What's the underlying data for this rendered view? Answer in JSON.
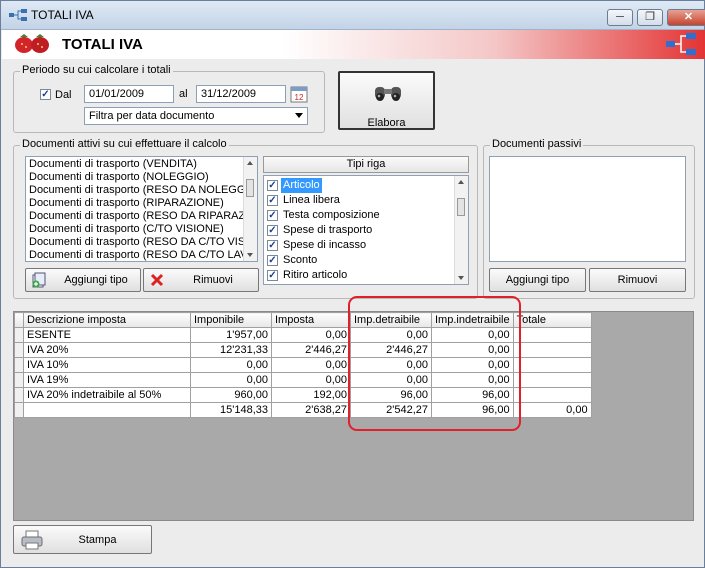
{
  "window": {
    "title": "TOTALI IVA",
    "minimize": "─",
    "maximize": "❐",
    "close": "✕"
  },
  "header": {
    "title": "TOTALI IVA"
  },
  "periodo": {
    "legend": "Periodo su cui calcolare i totali",
    "dal_checked": true,
    "dal_label": "Dal",
    "date_from": "01/01/2009",
    "al_label": "al",
    "date_to": "31/12/2009",
    "filter_selected": "Filtra per data documento"
  },
  "elabora": {
    "label": "Elabora"
  },
  "documenti_attivi": {
    "legend": "Documenti attivi su cui effettuare il calcolo",
    "items": [
      "Documenti di trasporto (VENDITA)",
      "Documenti di trasporto (NOLEGGIO)",
      "Documenti di trasporto (RESO DA NOLEGGI",
      "Documenti di trasporto (RIPARAZIONE)",
      "Documenti di trasporto (RESO DA RIPARAZI",
      "Documenti di trasporto (C/TO VISIONE)",
      "Documenti di trasporto (RESO DA C/TO VISI",
      "Documenti di trasporto (RESO DA C/TO LAV"
    ],
    "add_button": "Aggiungi tipo",
    "remove_button": "Rimuovi"
  },
  "tipi_riga": {
    "header": "Tipi riga",
    "items": [
      {
        "label": "Articolo",
        "checked": true,
        "selected": true
      },
      {
        "label": "Linea libera",
        "checked": true,
        "selected": false
      },
      {
        "label": "Testa composizione",
        "checked": true,
        "selected": false
      },
      {
        "label": "Spese di trasporto",
        "checked": true,
        "selected": false
      },
      {
        "label": "Spese di incasso",
        "checked": true,
        "selected": false
      },
      {
        "label": "Sconto",
        "checked": true,
        "selected": false
      },
      {
        "label": "Ritiro articolo",
        "checked": true,
        "selected": false
      }
    ]
  },
  "documenti_passivi": {
    "legend": "Documenti passivi",
    "add_button": "Aggiungi tipo",
    "remove_button": "Rimuovi"
  },
  "grid": {
    "columns": [
      "Descrizione imposta",
      "Imponibile",
      "Imposta",
      "Imp.detraibile",
      "Imp.indetraibile",
      "Totale"
    ],
    "rows": [
      [
        "ESENTE",
        "1'957,00",
        "0,00",
        "0,00",
        "0,00",
        ""
      ],
      [
        "IVA 20%",
        "12'231,33",
        "2'446,27",
        "2'446,27",
        "0,00",
        ""
      ],
      [
        "IVA 10%",
        "0,00",
        "0,00",
        "0,00",
        "0,00",
        ""
      ],
      [
        "IVA 19%",
        "0,00",
        "0,00",
        "0,00",
        "0,00",
        ""
      ],
      [
        "IVA 20% indetraibile al 50%",
        "960,00",
        "192,00",
        "96,00",
        "96,00",
        ""
      ],
      [
        "",
        "15'148,33",
        "2'638,27",
        "2'542,27",
        "96,00",
        "0,00"
      ]
    ]
  },
  "stampa": {
    "label": "Stampa"
  }
}
